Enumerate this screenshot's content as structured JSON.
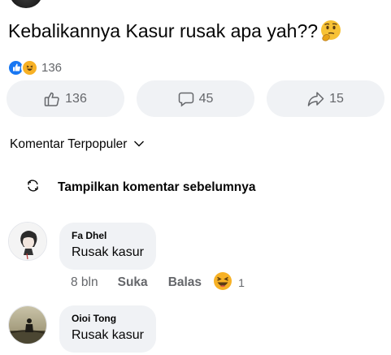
{
  "post": {
    "text": "Kebalikannya Kasur rusak apa yah??",
    "emoji": "thinking-face"
  },
  "reactions": {
    "types": [
      "like",
      "haha"
    ],
    "count": "136"
  },
  "actions": {
    "like_count": "136",
    "comment_count": "45",
    "share_count": "15"
  },
  "comments_section": {
    "sort_label": "Komentar Terpopuler",
    "view_previous": "Tampilkan komentar sebelumnya"
  },
  "comments": [
    {
      "author": "Fa Dhel",
      "text": "Rusak kasur",
      "time": "8 bln",
      "like_label": "Suka",
      "reply_label": "Balas",
      "reaction": "haha",
      "reaction_count": "1"
    },
    {
      "author": "Oioi Tong",
      "text": "Rusak kasur"
    }
  ],
  "colors": {
    "pill_bg": "#f0f2f5",
    "secondary_text": "#65676b",
    "like_blue": "#1877f2",
    "haha_yellow": "#f7b125"
  }
}
